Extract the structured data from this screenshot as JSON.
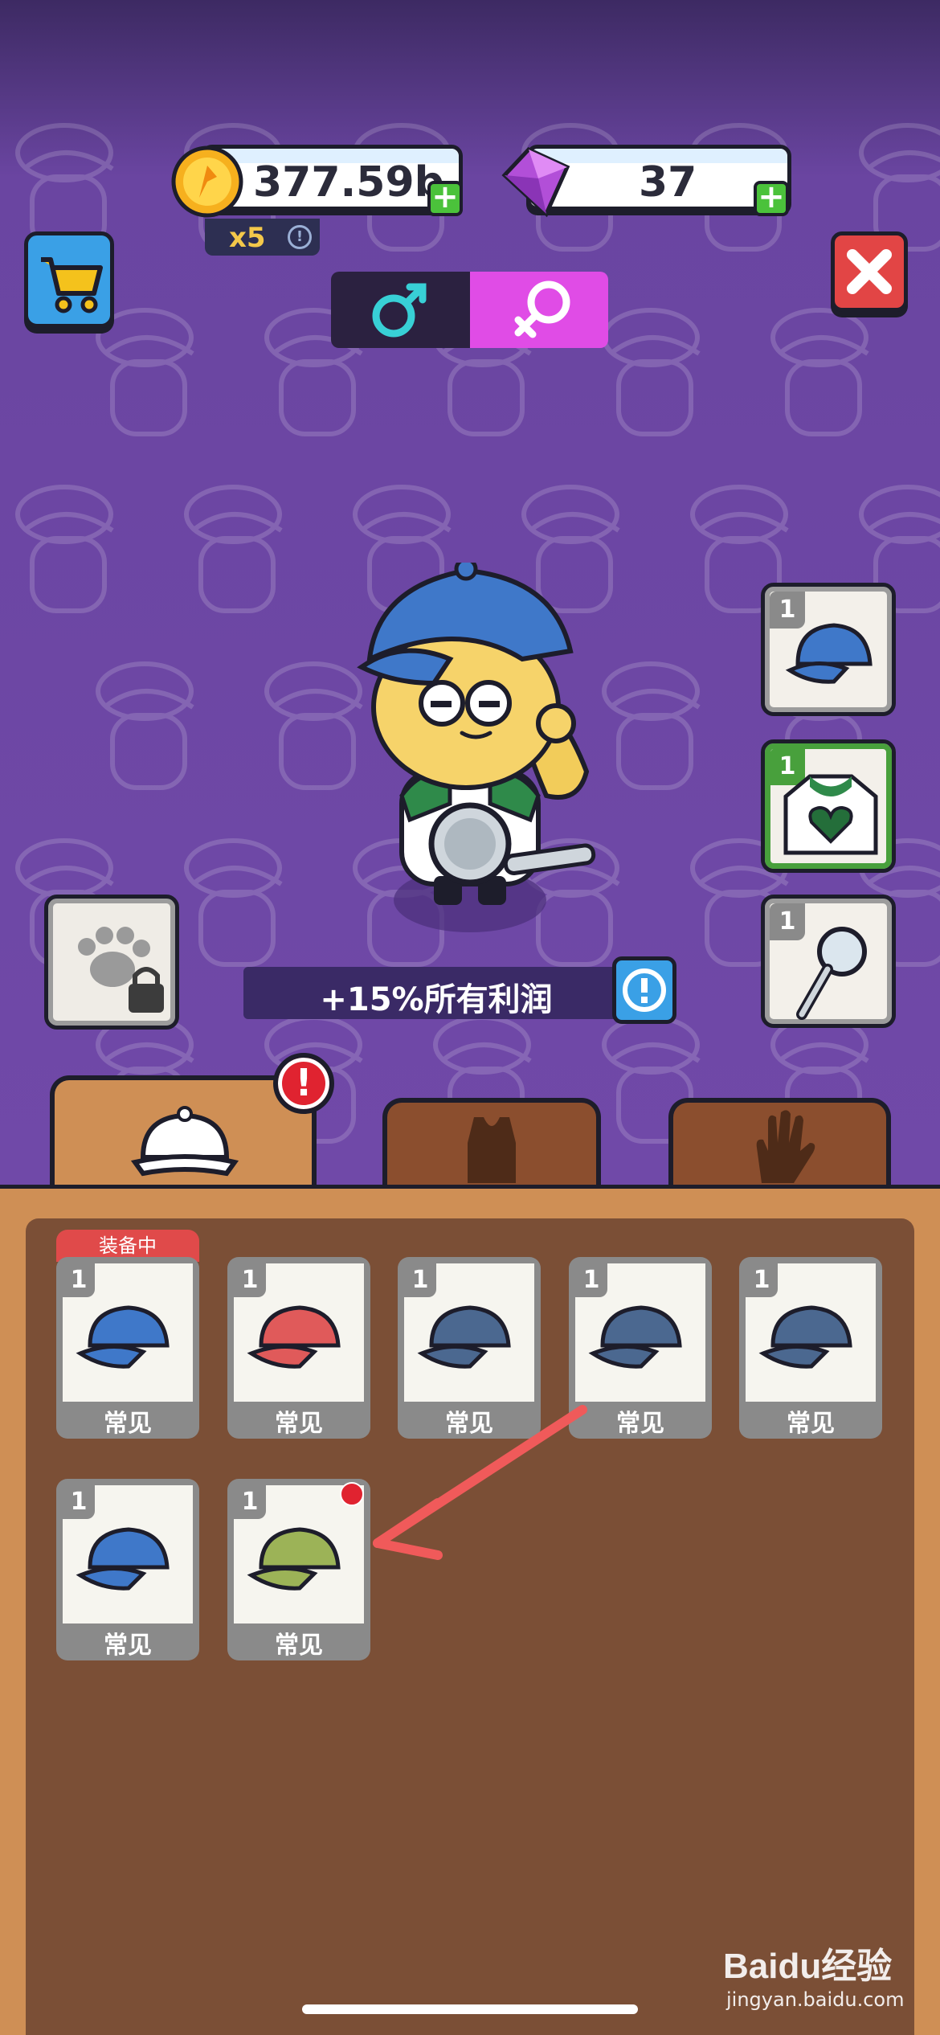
{
  "currency": {
    "coins": "377.59b",
    "gems": "37",
    "multiplier": "x5"
  },
  "bonus": {
    "text": "+15%所有利润"
  },
  "equipped_slots": [
    {
      "count": "1",
      "icon": "blue-cap-icon"
    },
    {
      "count": "1",
      "icon": "green-heart-shirt-icon"
    },
    {
      "count": "1",
      "icon": "magnifier-icon"
    }
  ],
  "equipped_tag": "装备中",
  "inventory": [
    {
      "count": "1",
      "label": "常见",
      "color": "#3f78c9"
    },
    {
      "count": "1",
      "label": "常见",
      "color": "#e05a5a"
    },
    {
      "count": "1",
      "label": "常见",
      "color": "#4b6890"
    },
    {
      "count": "1",
      "label": "常见",
      "color": "#4b6890"
    },
    {
      "count": "1",
      "label": "常见",
      "color": "#4b6890"
    },
    {
      "count": "1",
      "label": "常见",
      "color": "#3f78c9"
    },
    {
      "count": "1",
      "label": "常见",
      "color": "#9cb357"
    }
  ],
  "tabs": [
    {
      "icon": "cap-icon",
      "active": true
    },
    {
      "icon": "shirt-icon",
      "active": false
    },
    {
      "icon": "hand-icon",
      "active": false
    }
  ],
  "watermark": {
    "brand": "Baidu经验",
    "url": "jingyan.baidu.com"
  },
  "colors": {
    "accent_female": "#e04ce6",
    "alert": "#e02330",
    "panel": "#7b4f36"
  }
}
